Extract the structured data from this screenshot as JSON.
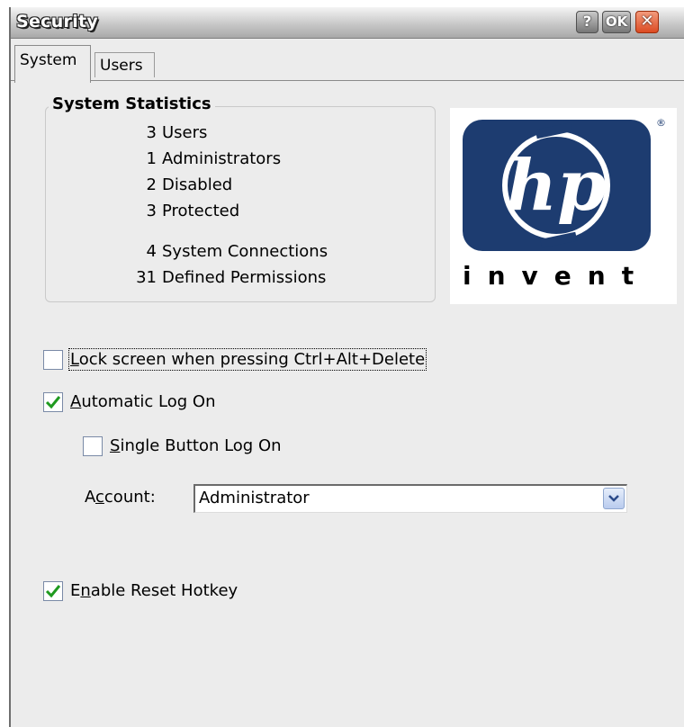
{
  "window": {
    "title": "Security",
    "help_button": "?",
    "ok_button": "OK",
    "close_button": "✕"
  },
  "tabs": [
    {
      "label": "System",
      "active": true
    },
    {
      "label": "Users",
      "active": false
    }
  ],
  "statistics": {
    "title": "System Statistics",
    "rows": [
      {
        "count": "3",
        "label": "Users"
      },
      {
        "count": "1",
        "label": "Administrators"
      },
      {
        "count": "2",
        "label": "Disabled"
      },
      {
        "count": "3",
        "label": "Protected"
      },
      {
        "count": "4",
        "label": "System Connections"
      },
      {
        "count": "31",
        "label": "Defined Permissions"
      }
    ]
  },
  "logo": {
    "mark": "hp",
    "tagline": "invent",
    "registered": "®",
    "color": "#1d3c70"
  },
  "options": {
    "lock_screen": {
      "mnemonic": "L",
      "rest": "ock screen when pressing Ctrl+Alt+Delete",
      "checked": false
    },
    "auto_logon": {
      "mnemonic": "A",
      "rest": "utomatic Log On",
      "checked": true
    },
    "single_button": {
      "mnemonic": "S",
      "rest": "ingle Button Log On",
      "checked": false
    },
    "reset_hotkey": {
      "prefix": "E",
      "mnemonic": "n",
      "rest": "able Reset Hotkey",
      "checked": true
    }
  },
  "account": {
    "label_prefix": "A",
    "label_mnemonic": "c",
    "label_rest": "count:",
    "selected": "Administrator"
  },
  "colors": {
    "check_mark": "#1f9a1f",
    "close_button": "#dc4b22"
  }
}
